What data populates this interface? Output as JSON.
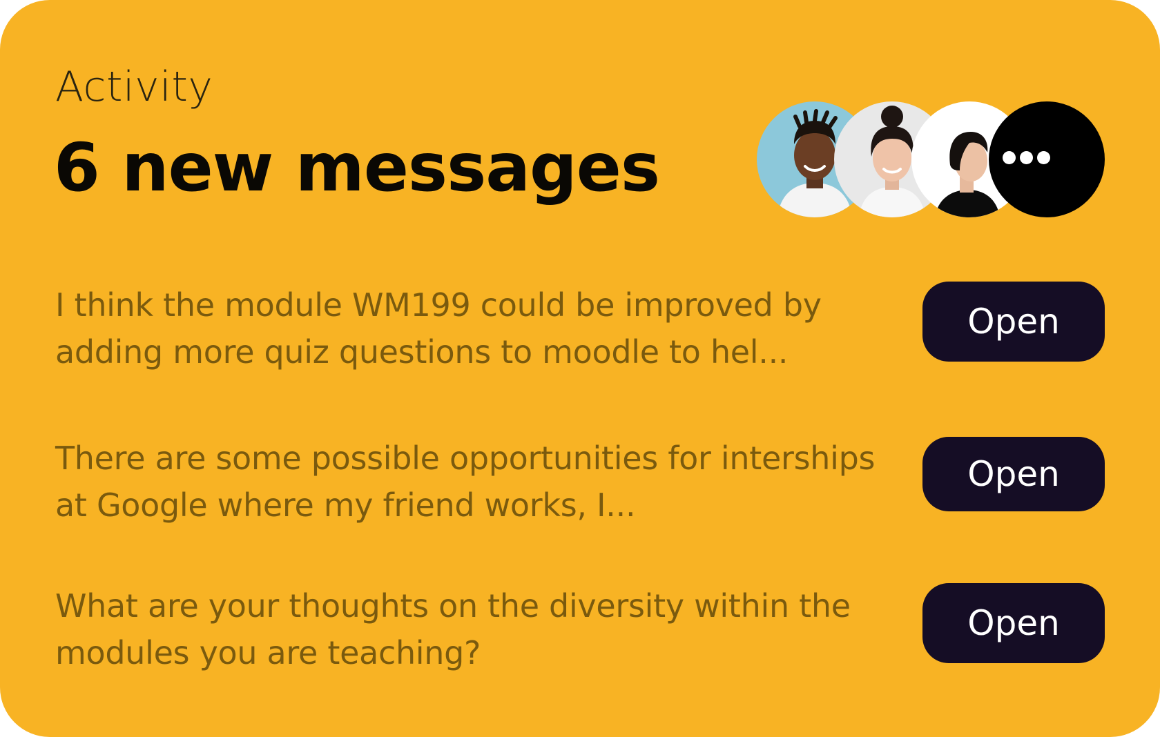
{
  "card": {
    "eyebrow": "Activity",
    "title": "6 new messages",
    "accent_color": "#F8B324",
    "button_color": "#150D25",
    "message_text_color": "#7A5A0E"
  },
  "avatars": [
    {
      "name": "avatar-man-icon"
    },
    {
      "name": "avatar-woman-icon"
    },
    {
      "name": "avatar-woman-profile-icon"
    },
    {
      "name": "more-icon"
    }
  ],
  "messages": [
    {
      "text": "I think the module WM199 could be improved by adding more quiz questions to moodle to hel...",
      "button_label": "Open"
    },
    {
      "text": "There are some possible opportunities for interships at Google where my friend works, I...",
      "button_label": "Open"
    },
    {
      "text": "What are your thoughts on the diversity within the modules you are teaching?",
      "button_label": "Open"
    }
  ]
}
